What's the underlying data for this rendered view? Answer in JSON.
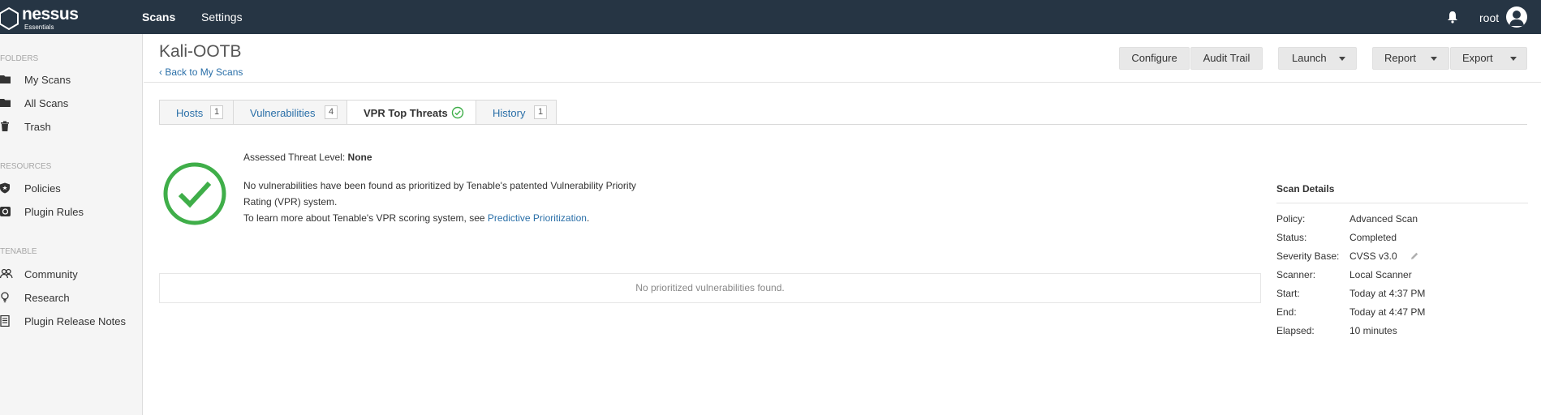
{
  "brand": {
    "name": "nessus",
    "edition": "Essentials"
  },
  "nav": {
    "scans": "Scans",
    "settings": "Settings"
  },
  "user": {
    "name": "root"
  },
  "sidebar": {
    "folders_heading": "FOLDERS",
    "folders": [
      {
        "label": "My Scans",
        "icon": "folder-icon"
      },
      {
        "label": "All Scans",
        "icon": "folder-icon"
      },
      {
        "label": "Trash",
        "icon": "trash-icon"
      }
    ],
    "resources_heading": "RESOURCES",
    "resources": [
      {
        "label": "Policies",
        "icon": "shield-icon"
      },
      {
        "label": "Plugin Rules",
        "icon": "plugin-rules-icon"
      }
    ],
    "tenable_heading": "TENABLE",
    "tenable": [
      {
        "label": "Community",
        "icon": "community-icon"
      },
      {
        "label": "Research",
        "icon": "lightbulb-icon"
      },
      {
        "label": "Plugin Release Notes",
        "icon": "document-icon"
      }
    ]
  },
  "page": {
    "title": "Kali-OOTB",
    "back_link": "Back to My Scans"
  },
  "toolbar": {
    "configure": "Configure",
    "audit_trail": "Audit Trail",
    "launch": "Launch",
    "report": "Report",
    "export": "Export"
  },
  "tabs": [
    {
      "label": "Hosts",
      "count": "1"
    },
    {
      "label": "Vulnerabilities",
      "count": "4"
    },
    {
      "label": "VPR Top Threats"
    },
    {
      "label": "History",
      "count": "1"
    }
  ],
  "vpr": {
    "threat_level_label": "Assessed Threat Level:",
    "threat_level_value": "None",
    "line1": "No vulnerabilities have been found as prioritized by Tenable's patented Vulnerability Priority",
    "line2": "Rating (VPR) system.",
    "line3_prefix": "To learn more about Tenable's VPR scoring system, see",
    "line3_link": "Predictive Prioritization",
    "line3_suffix": ".",
    "empty_message": "No prioritized vulnerabilities found."
  },
  "scan_details": {
    "title": "Scan Details",
    "rows": [
      {
        "key": "Policy:",
        "value": "Advanced Scan"
      },
      {
        "key": "Status:",
        "value": "Completed"
      },
      {
        "key": "Severity Base:",
        "value": "CVSS v3.0"
      },
      {
        "key": "Scanner:",
        "value": "Local Scanner"
      },
      {
        "key": "Start:",
        "value": "Today at 4:37 PM"
      },
      {
        "key": "End:",
        "value": "Today at 4:47 PM"
      },
      {
        "key": "Elapsed:",
        "value": "10 minutes"
      }
    ]
  },
  "colors": {
    "topbar": "#263544",
    "link": "#2a6fa8",
    "success": "#3fae49"
  }
}
